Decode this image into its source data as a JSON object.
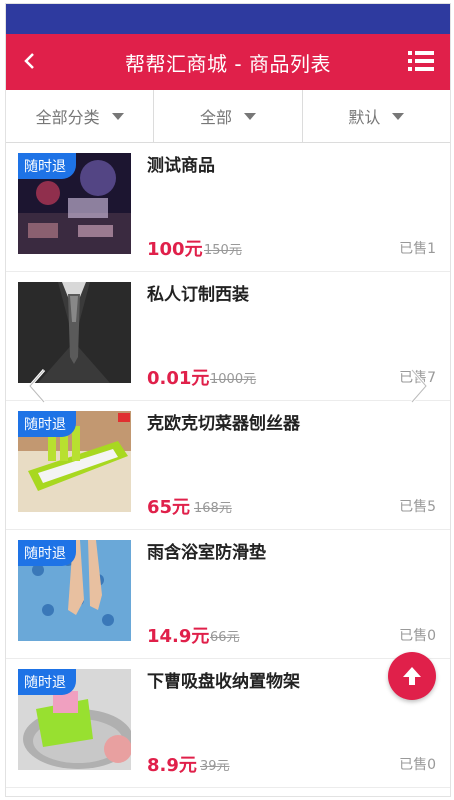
{
  "header": {
    "title": "帮帮汇商城 - 商品列表"
  },
  "filters": [
    {
      "label": "全部分类"
    },
    {
      "label": "全部"
    },
    {
      "label": "默认"
    }
  ],
  "products": [
    {
      "name": "测试商品",
      "price": "100元",
      "old_price": "150元",
      "sold": "已售1",
      "badge": "随时退"
    },
    {
      "name": "私人订制西装",
      "price": "0.01元",
      "old_price": "1000元",
      "sold": "已售7",
      "badge": ""
    },
    {
      "name": "克欧克切菜器刨丝器",
      "price": "65元",
      "old_price": "168元",
      "sold": "已售5",
      "badge": "随时退"
    },
    {
      "name": "雨含浴室防滑垫",
      "price": "14.9元",
      "old_price": "66元",
      "sold": "已售0",
      "badge": "随时退"
    },
    {
      "name": "下曹吸盘收纳置物架",
      "price": "8.9元",
      "old_price": "39元",
      "sold": "已售0",
      "badge": "随时退"
    }
  ],
  "colors": {
    "header": "#e0204a",
    "statusbar": "#2e3a9f",
    "badge": "#1e73e6",
    "price": "#e0204a"
  }
}
